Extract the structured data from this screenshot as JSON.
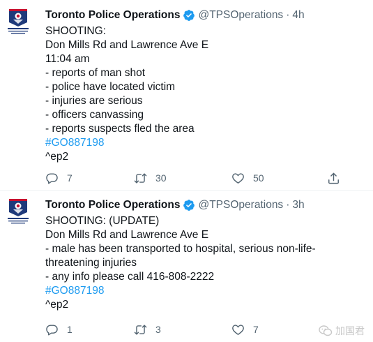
{
  "colors": {
    "link": "#1d9bf0",
    "secondary_text": "#536471",
    "primary_text": "#0f1419",
    "verified": "#1d9bf0"
  },
  "tweets": [
    {
      "name": "Toronto Police Operations",
      "handle": "@TPSOperations",
      "separator": "·",
      "time": "4h",
      "avatar_text": "TORONTO POLICE OPERATIONS CENTRE",
      "lines": [
        "SHOOTING:",
        "Don Mills Rd and Lawrence Ave E",
        "11:04 am",
        "- reports of man shot",
        "- police have located victim",
        "- injuries are serious",
        "- officers canvassing",
        "- reports suspects fled the area"
      ],
      "hashtag": "#GO887198",
      "signature": "^ep2",
      "replies": "7",
      "retweets": "30",
      "likes": "50"
    },
    {
      "name": "Toronto Police Operations",
      "handle": "@TPSOperations",
      "separator": "·",
      "time": "3h",
      "avatar_text": "TORONTO POLICE OPERATIONS CENTRE",
      "lines": [
        "SHOOTING: (UPDATE)",
        "Don Mills Rd and Lawrence Ave E",
        "- male has been transported to hospital, serious non-life-threatening injuries",
        "- any info please call 416-808-2222"
      ],
      "hashtag": "#GO887198",
      "signature": "^ep2",
      "replies": "1",
      "retweets": "3",
      "likes": "7"
    }
  ],
  "watermark": {
    "text": "加国君",
    "icon": "wechat-icon"
  }
}
